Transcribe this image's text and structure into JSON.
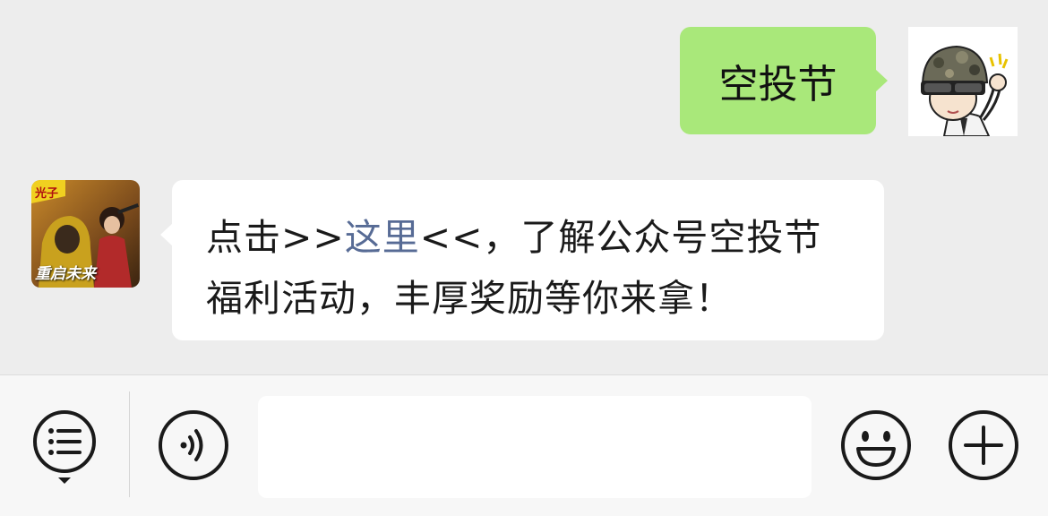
{
  "messages": {
    "outgoing": {
      "text": "空投节",
      "bubble_color": "#a9e87a"
    },
    "incoming": {
      "prefix": "点击>>",
      "link": "这里",
      "suffix": "<<，了解公众号空投节福利活动，丰厚奖励等你来拿！",
      "link_color": "#576b95",
      "avatar_badge": "光子",
      "avatar_caption": "重启未来"
    }
  },
  "input_bar": {
    "menu_icon": "list-menu-icon",
    "voice_icon": "voice-icon",
    "emoji_icon": "emoji-icon",
    "plus_icon": "plus-icon",
    "input_value": "",
    "input_placeholder": ""
  },
  "colors": {
    "chat_background": "#ededed",
    "bar_background": "#f7f7f7",
    "icon_stroke": "#1a1a1a"
  }
}
